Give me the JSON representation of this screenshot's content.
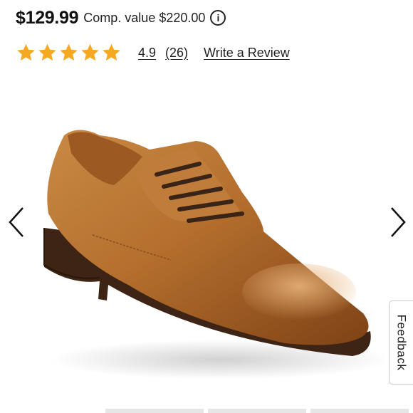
{
  "product": {
    "price": "$129.99",
    "comp_value": "Comp. value $220.00",
    "rating": {
      "value": "4.9",
      "count": "(26)",
      "stars": 5,
      "star_color": "#F6A821"
    },
    "write_review_label": "Write a Review"
  },
  "icons": {
    "info": "info-icon",
    "prev": "chevron-left-icon",
    "next": "chevron-right-icon",
    "star": "star-icon"
  },
  "info_glyph": "i",
  "feedback_label": "Feedback"
}
